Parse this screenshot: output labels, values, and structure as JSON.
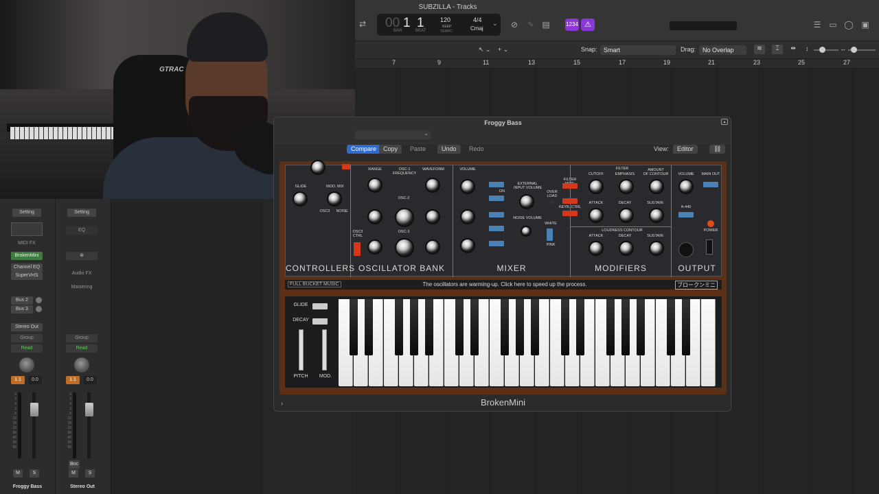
{
  "window": {
    "title": "SUBZILLA - Tracks"
  },
  "lcd": {
    "bar": "1",
    "beat": "1",
    "bar_label": "BAR",
    "beat_label": "BEAT",
    "tempo": "120",
    "tempo_sub": "KEEP",
    "tempo_label": "TEMPO",
    "time_sig": "4/4",
    "key": "Cmaj",
    "prefix": "00"
  },
  "badges": {
    "count_in": "1234"
  },
  "toolbar": {
    "snap_label": "Snap:",
    "snap_value": "Smart",
    "drag_label": "Drag:",
    "drag_value": "No Overlap"
  },
  "ruler": {
    "marks": [
      "7",
      "9",
      "11",
      "13",
      "15",
      "17",
      "19",
      "21",
      "23",
      "25",
      "27"
    ]
  },
  "plugin": {
    "title": "Froggy Bass",
    "compare": "Compare",
    "copy": "Copy",
    "paste": "Paste",
    "undo": "Undo",
    "redo": "Redo",
    "view_label": "View:",
    "view_value": "Editor",
    "name": "BrokenMini",
    "brand": "FULL BUCKET MUSIC",
    "message": "The oscillators are warming-up. Click here to speed up the process.",
    "lang_button": "ブロークンミニ",
    "sections": {
      "controllers": "CONTROLLERS",
      "oscillator_bank": "OSCILLATOR BANK",
      "mixer": "MIXER",
      "modifiers": "MODIFIERS",
      "output": "OUTPUT"
    },
    "labels": {
      "glide": "GLIDE",
      "mod_mix": "MOD. MIX",
      "osc3": "OSC3",
      "noise": "NOISE",
      "range": "RANGE",
      "osc1_freq": "OSC-1\nFREQUENCY",
      "waveform": "WAVEFORM",
      "osc2": "OSC-2",
      "osc3b": "OSC-3",
      "osc3_ctrl": "OSC3\nCTRL",
      "volume": "VOLUME",
      "on": "ON",
      "ext_input": "EXTERNAL\nINPUT VOLUME",
      "overload": "OVER\nLOAD",
      "noise_volume": "NOISE VOLUME",
      "white": "WHITE",
      "pink": "PINK",
      "filter_mod": "FILTER MOD.",
      "keyb_ctrl": "KEYB. CTRL",
      "filter": "FILTER",
      "cutoff": "CUTOFF",
      "emphasis": "EMPHASIS",
      "amount_contour": "AMOUNT\nOF CONTOUR",
      "attack": "ATTACK",
      "decay": "DECAY",
      "sustain": "SUSTAIN",
      "loudness_contour": "LOUDNESS CONTOUR",
      "main_out": "MAIN OUT",
      "a440": "A-440",
      "power": "POWER",
      "glide_kb": "GLIDE",
      "decay_kb": "DECAY",
      "pitch": "PITCH",
      "mod": "MOD."
    }
  },
  "mixer": {
    "channels": [
      {
        "setting": "Setting",
        "midi_fx": "MIDI FX",
        "instrument": "BrokenMini",
        "plugins": [
          "Channel EQ",
          "SuperVHS"
        ],
        "sends": [
          "Bus 2",
          "Bus 3"
        ],
        "output": "Stereo Out",
        "group": "Group",
        "automation": "Read",
        "pan": "1.1",
        "vol": "0.0",
        "mute": "M",
        "solo": "S",
        "name": "Froggy Bass"
      },
      {
        "setting": "Setting",
        "eq": "EQ",
        "audio_fx": "Audio FX",
        "mastering": "Mastering",
        "group": "Group",
        "automation": "Read",
        "pan": "1.1",
        "vol": "0.0",
        "bnc": "Bnc",
        "mute": "M",
        "solo": "S",
        "name": "Stereo Out"
      }
    ]
  },
  "webcam": {
    "logo_text": "GTRAC"
  },
  "colors": {
    "accent_green": "#3b7d3e",
    "accent_orange": "#c06e25",
    "purple": "#8b36d6",
    "blue_rocker": "#4a82b8",
    "red_rocker": "#d6381c"
  }
}
